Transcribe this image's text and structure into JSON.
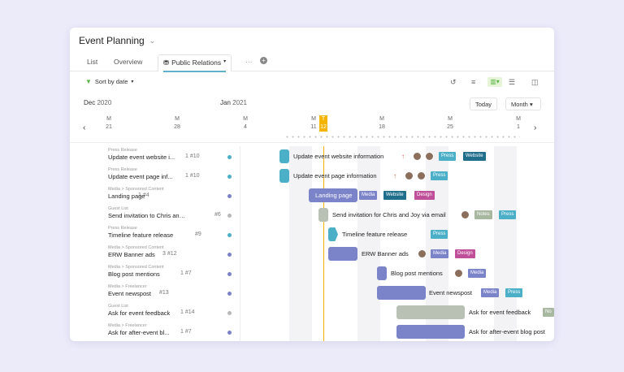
{
  "app": {
    "title": "Event Planning"
  },
  "tabs": {
    "list": "List",
    "overview": "Overview",
    "public_relations": "Public Relations"
  },
  "toolbar": {
    "sort": "Sort by date"
  },
  "timeline": {
    "dec": "Dec",
    "dec_year": "2020",
    "jan": "Jan",
    "jan_year": "2021",
    "today_btn": "Today",
    "month_btn": "Month",
    "days": [
      {
        "w": "M",
        "d": "21"
      },
      {
        "w": "M",
        "d": "28"
      },
      {
        "w": "M",
        "d": "4"
      },
      {
        "w": "M",
        "d": "11"
      },
      {
        "w": "T",
        "d": "12"
      },
      {
        "w": "M",
        "d": "18"
      },
      {
        "w": "M",
        "d": "25"
      },
      {
        "w": "M",
        "d": "1"
      }
    ]
  },
  "tasks": [
    {
      "path": "Press Release",
      "name": "Update event website i...",
      "meta": "1 #10",
      "dot": "#4bb0c7"
    },
    {
      "path": "Press Release",
      "name": "Update event page inf...",
      "meta": "1 #10",
      "dot": "#4bb0c7"
    },
    {
      "path": "Media > Sponsored Content",
      "name": "Landing page",
      "meta": "1 #4",
      "dot": "#7b83c9"
    },
    {
      "path": "Guest List",
      "name": "Send invitation to Chris and Joy ...",
      "meta": "#6",
      "dot": "#b9b9b9"
    },
    {
      "path": "Press Release",
      "name": "Timeline feature release",
      "meta": "#9",
      "dot": "#4bb0c7"
    },
    {
      "path": "Media > Sponsored Content",
      "name": "ERW Banner ads",
      "meta": "3 #12",
      "dot": "#7b83c9"
    },
    {
      "path": "Media > Sponsored Content",
      "name": "Blog post mentions",
      "meta": "1 #7",
      "dot": "#7b83c9"
    },
    {
      "path": "Media > Freelancer",
      "name": "Event newspost",
      "meta": "#13",
      "dot": "#7b83c9"
    },
    {
      "path": "Guest List",
      "name": "Ask for event feedback",
      "meta": "1 #14",
      "dot": "#b9b9b9"
    },
    {
      "path": "Media > Freelancer",
      "name": "Ask for after-event bl...",
      "meta": "1 #7",
      "dot": "#7b83c9"
    }
  ],
  "bars": [
    {
      "label": "Update event website information",
      "tags": [
        "Press",
        "Website"
      ]
    },
    {
      "label": "Update event page information",
      "tags": [
        "Press"
      ]
    },
    {
      "label": "Landing page",
      "tags": [
        "Media",
        "Website",
        "Design"
      ]
    },
    {
      "label": "Send invitation for Chris and Joy via email",
      "tags": [
        "Notes",
        "Press"
      ]
    },
    {
      "label": "Timeline feature release",
      "tags": [
        "Press"
      ]
    },
    {
      "label": "ERW Banner ads",
      "tags": [
        "Media",
        "Design"
      ]
    },
    {
      "label": "Blog post mentions",
      "tags": [
        "Media"
      ]
    },
    {
      "label": "Event newspost",
      "tags": [
        "Media",
        "Press"
      ]
    },
    {
      "label": "Ask for event feedback",
      "tags": [
        "No"
      ]
    },
    {
      "label": "Ask for after-event blog post",
      "tags": []
    }
  ],
  "colors": {
    "press": "#4bb0c7",
    "media": "#7b83c9",
    "guest": "#b9c0b4",
    "today": "#f5b400",
    "website": "#1f6e8c",
    "design": "#c04f9a",
    "notes": "#a8b7a0"
  }
}
